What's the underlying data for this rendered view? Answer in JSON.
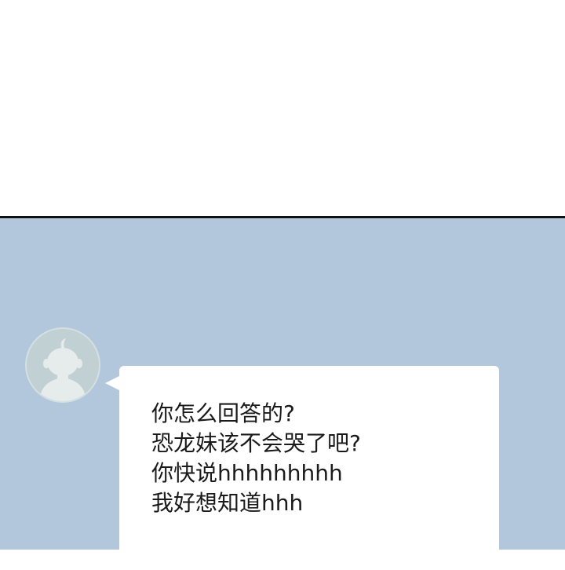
{
  "chat": {
    "avatar_icon": "user-silhouette-icon",
    "background_color": "#b3c7dc",
    "bubble_color": "#ffffff",
    "message_lines": [
      "你怎么回答的?",
      "恐龙妹该不会哭了吧?",
      "你快说hhhhhhhhh",
      "我好想知道hhh"
    ]
  }
}
